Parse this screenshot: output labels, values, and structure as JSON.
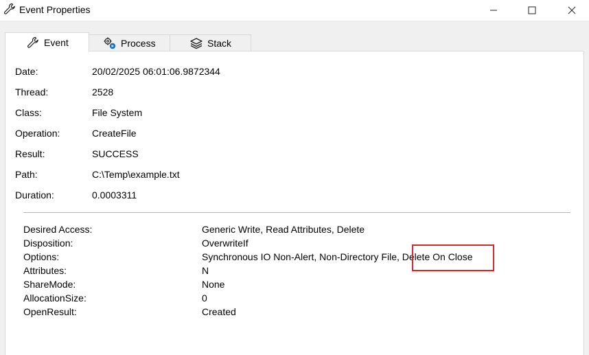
{
  "window": {
    "title": "Event Properties"
  },
  "tabs": [
    {
      "label": "Event",
      "icon": "wrench-icon",
      "active": true
    },
    {
      "label": "Process",
      "icon": "gears-icon",
      "active": false
    },
    {
      "label": "Stack",
      "icon": "layers-icon",
      "active": false
    }
  ],
  "event": {
    "fields": [
      {
        "label": "Date:",
        "value": "20/02/2025 06:01:06.9872344"
      },
      {
        "label": "Thread:",
        "value": "2528"
      },
      {
        "label": "Class:",
        "value": "File System"
      },
      {
        "label": "Operation:",
        "value": "CreateFile"
      },
      {
        "label": "Result:",
        "value": "SUCCESS"
      },
      {
        "label": "Path:",
        "value": "C:\\Temp\\example.txt"
      },
      {
        "label": "Duration:",
        "value": "0.0003311"
      }
    ]
  },
  "details": [
    {
      "label": "Desired Access:",
      "value": "Generic Write, Read Attributes, Delete"
    },
    {
      "label": "Disposition:",
      "value": "OverwriteIf"
    },
    {
      "label": "Options:",
      "value": "Synchronous IO Non-Alert, Non-Directory File, Delete On Close"
    },
    {
      "label": "Attributes:",
      "value": "N"
    },
    {
      "label": "ShareMode:",
      "value": "None"
    },
    {
      "label": "AllocationSize:",
      "value": "0"
    },
    {
      "label": "OpenResult:",
      "value": "Created"
    }
  ],
  "colors": {
    "highlight": "#d9262c",
    "process_icon_accent": "#1a73c8"
  }
}
